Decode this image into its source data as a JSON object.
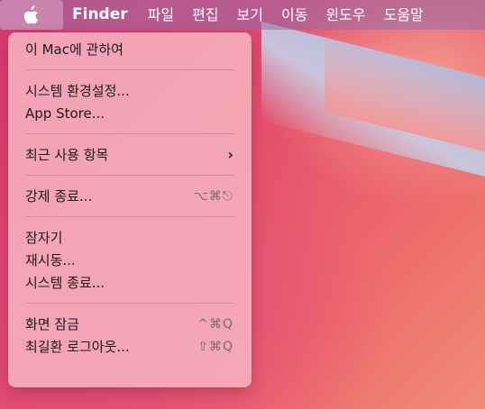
{
  "menubar": {
    "apple_icon": "apple-icon",
    "app_name": "Finder",
    "menus": [
      "파일",
      "편집",
      "보기",
      "이동",
      "윈도우",
      "도움말"
    ]
  },
  "apple_menu": {
    "about": "이 Mac에 관하여",
    "system_prefs": "시스템 환경설정...",
    "app_store": "App Store...",
    "recent_items": "최근 사용 항목",
    "recent_items_chevron": "›",
    "force_quit": "강제 종료...",
    "force_quit_shortcut": "⌥⌘⎋",
    "sleep": "잠자기",
    "restart": "재시동...",
    "shutdown": "시스템 종료...",
    "lock_screen": "화면 잠금",
    "lock_screen_shortcut": "^⌘Q",
    "log_out": "최길환 로그아웃...",
    "log_out_shortcut": "⇧⌘Q"
  },
  "colors": {
    "menu_background": "#f6bac4",
    "menubar_tint": "#966eaa",
    "wallpaper_main": "#e4506c"
  }
}
